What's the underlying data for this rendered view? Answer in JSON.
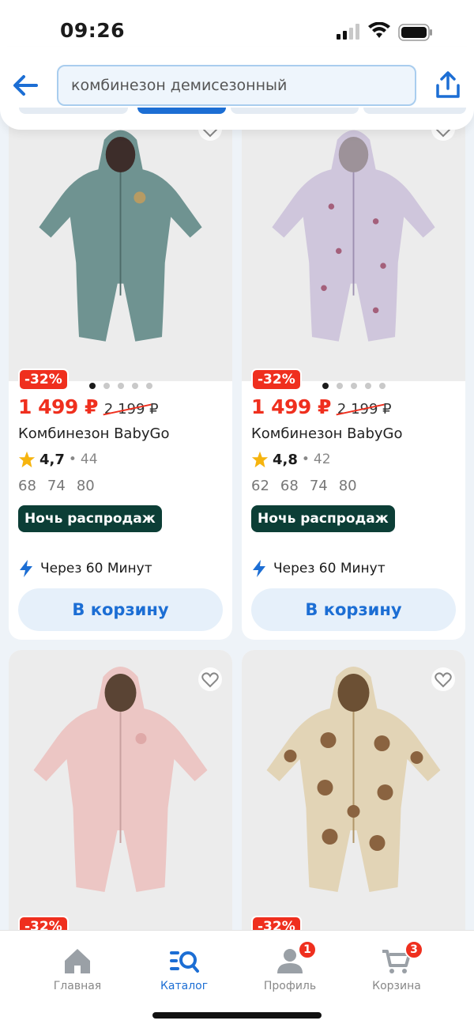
{
  "status_bar": {
    "time": "09:26"
  },
  "search": {
    "query": "комбинезон демисезонный"
  },
  "products": [
    {
      "discount": "-32%",
      "price": "1 499 ₽",
      "old_price": "2 199 ₽",
      "title": "Комбинезон BabyGo",
      "rating": "4,7",
      "reviews": "44",
      "sizes": [
        "68",
        "74",
        "80"
      ],
      "promo": "Ночь распродаж",
      "delivery": "Через 60 Минут",
      "button": "В корзину",
      "color": "#6f9391"
    },
    {
      "discount": "-32%",
      "price": "1 499 ₽",
      "old_price": "2 199 ₽",
      "title": "Комбинезон BabyGo",
      "rating": "4,8",
      "reviews": "42",
      "sizes": [
        "62",
        "68",
        "74",
        "80"
      ],
      "promo": "Ночь распродаж",
      "delivery": "Через 60 Минут",
      "button": "В корзину",
      "color": "#cfc6dc"
    },
    {
      "discount": "-32%",
      "color": "#ecc6c4"
    },
    {
      "discount": "-32%",
      "color": "#e2d4b6"
    }
  ],
  "rating_separator": "•",
  "tabs": [
    {
      "label": "Главная",
      "icon": "home-icon"
    },
    {
      "label": "Каталог",
      "icon": "catalog-search-icon"
    },
    {
      "label": "Профиль",
      "icon": "profile-icon",
      "badge": "1"
    },
    {
      "label": "Корзина",
      "icon": "cart-icon",
      "badge": "3"
    }
  ],
  "colors": {
    "accent": "#1c6ed4",
    "sale": "#ef2f1e",
    "promo_bg": "#0c3e36"
  }
}
